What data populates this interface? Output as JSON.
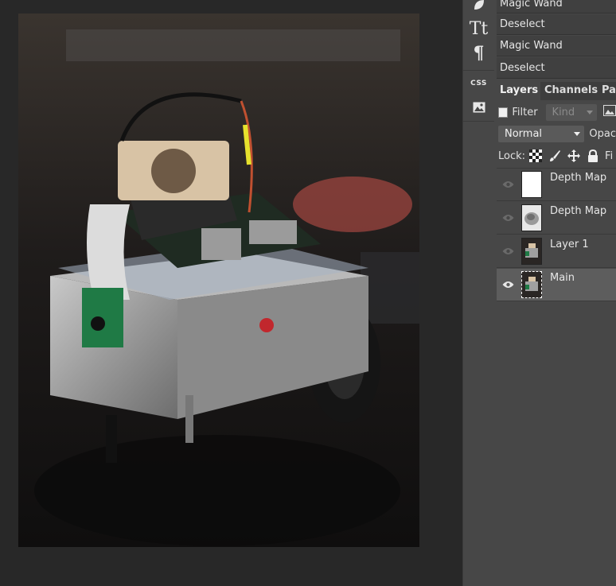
{
  "history": [
    "Magic Wand",
    "Deselect",
    "Magic Wand",
    "Deselect"
  ],
  "tools": {
    "shape_icon": "leaf-shape-icon",
    "text_icon": "text-tool-icon",
    "text_glyph": "Tt",
    "paragraph_icon": "paragraph-icon",
    "paragraph_glyph": "¶",
    "css_icon": "css-icon",
    "css_label": "CSS",
    "image_icon": "image-icon"
  },
  "tabs": [
    {
      "label": "Layers",
      "active": true
    },
    {
      "label": "Channels",
      "active": false
    },
    {
      "label": "Pat",
      "active": false
    }
  ],
  "filter": {
    "label": "Filter",
    "kind_placeholder": "Kind"
  },
  "blend": {
    "mode": "Normal",
    "opacity_label": "Opac"
  },
  "lock": {
    "label": "Lock:",
    "fill_label": "Fi"
  },
  "layers": [
    {
      "name": "Depth Map",
      "thumb": "white",
      "active": false
    },
    {
      "name": "Depth Map",
      "thumb": "gray-depth",
      "active": false
    },
    {
      "name": "Layer 1",
      "thumb": "photo",
      "active": false
    },
    {
      "name": "Main",
      "thumb": "photo-selected",
      "active": true
    }
  ],
  "colors": {
    "panel": "#474747",
    "active_layer": "#5d5d5d",
    "background": "#282828"
  }
}
